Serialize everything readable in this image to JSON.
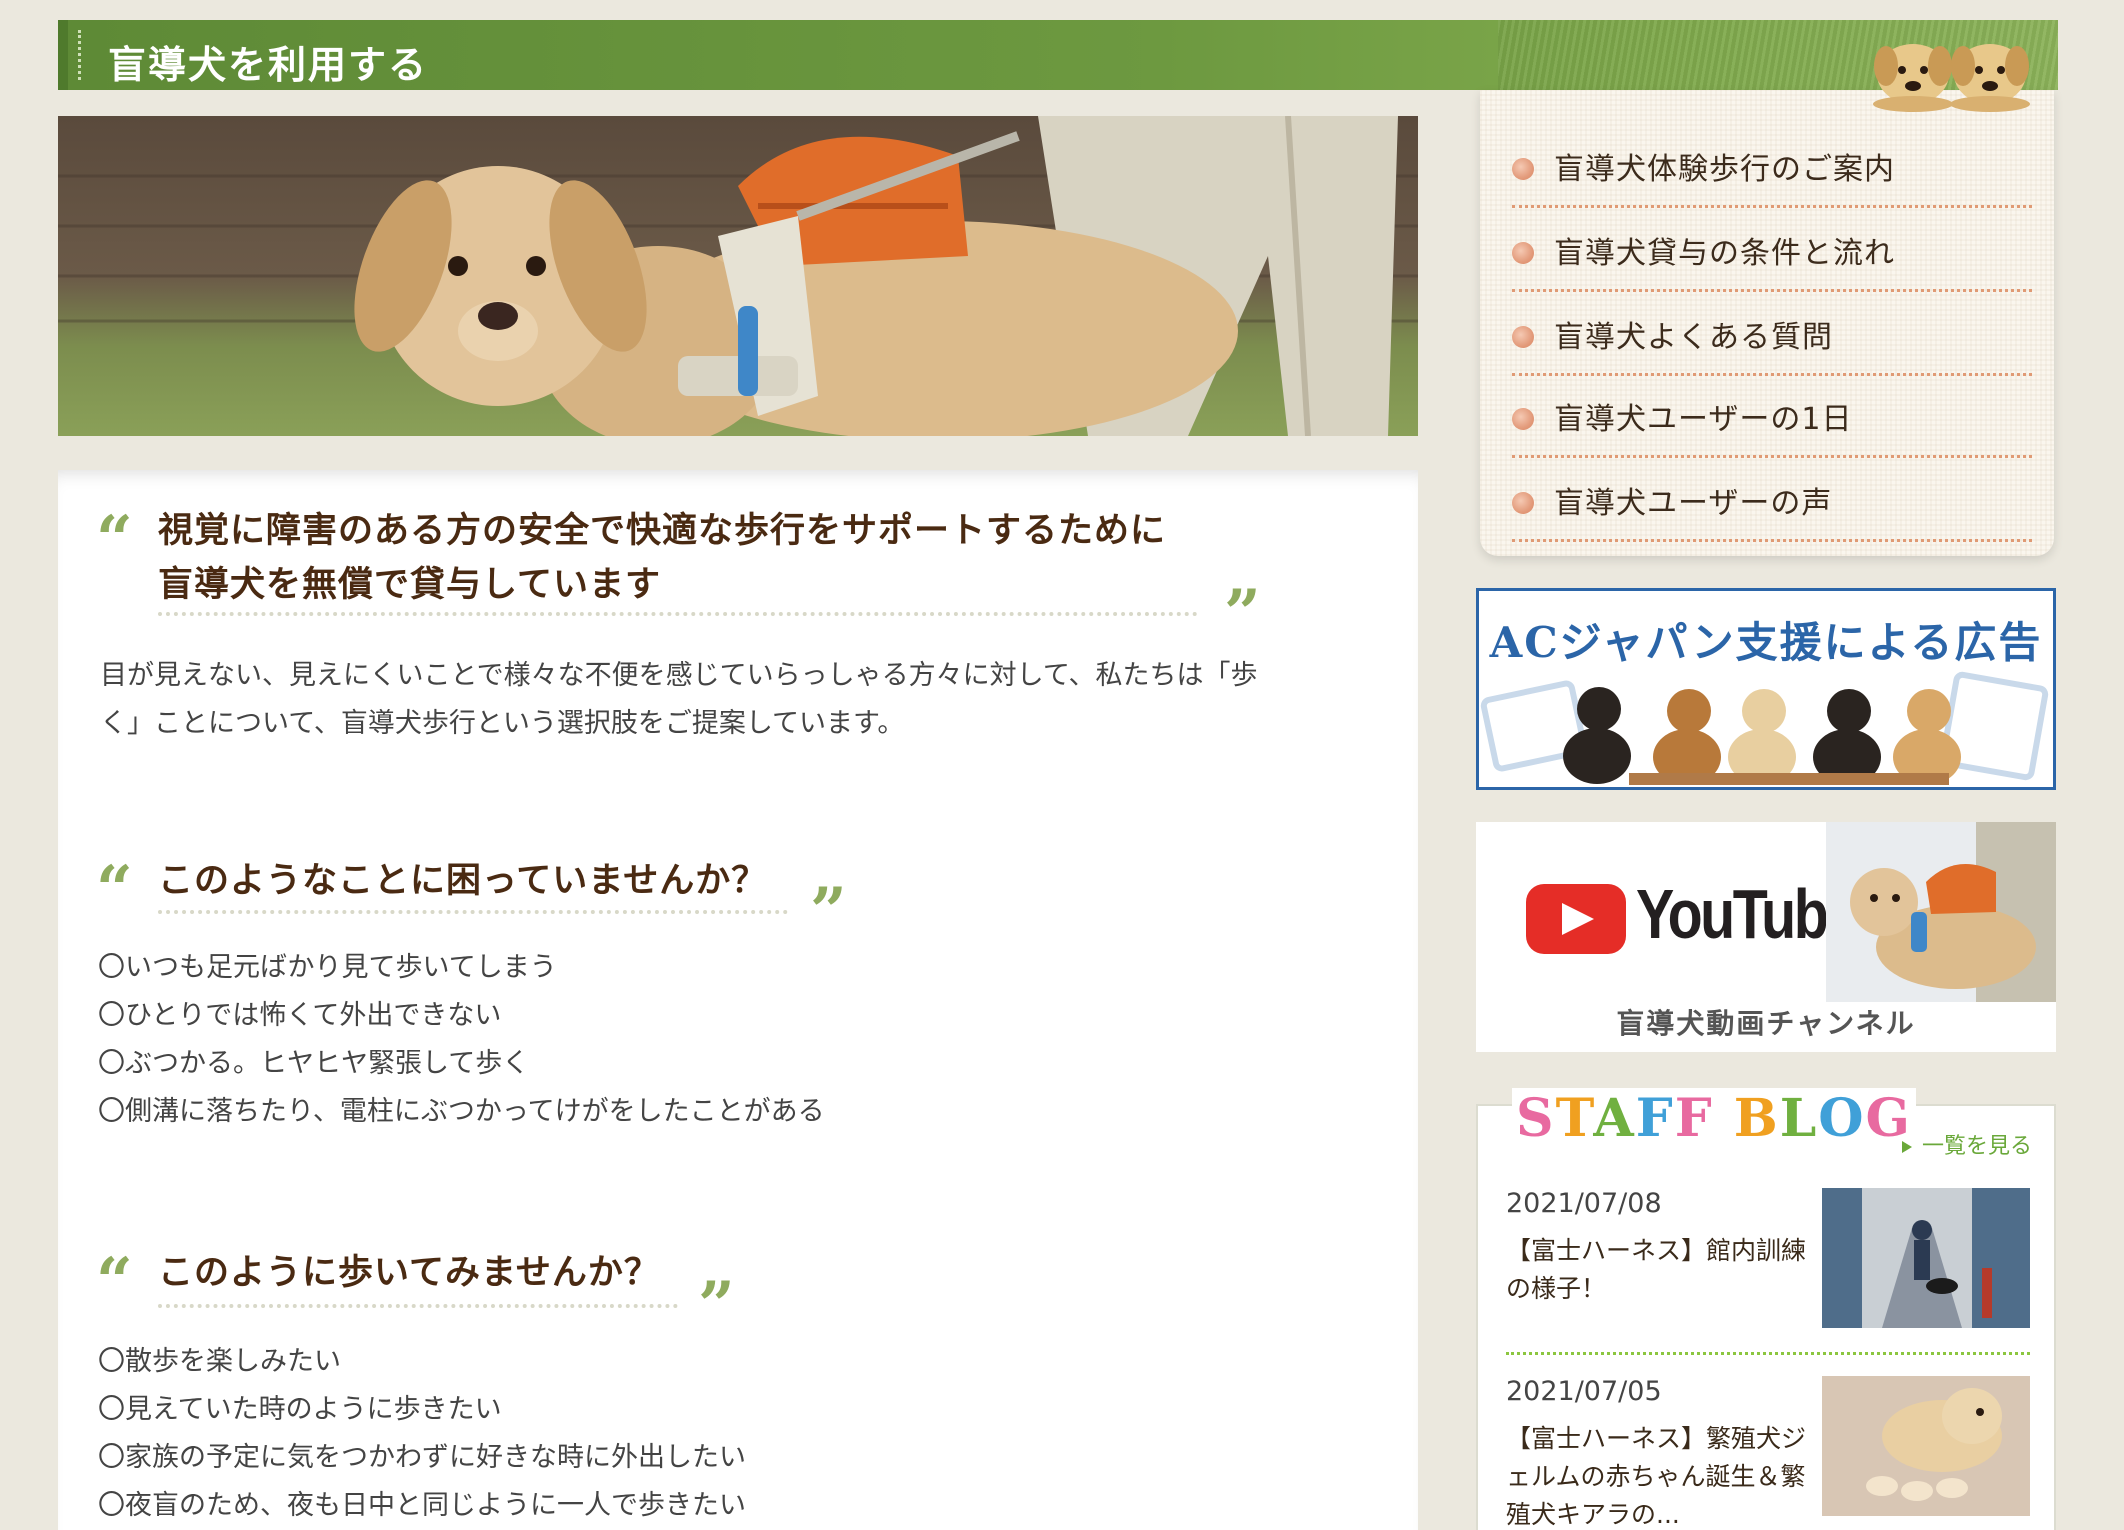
{
  "header": {
    "title": "盲導犬を利用する"
  },
  "hero": {
    "image": "guide-dog-with-harness-photo"
  },
  "intro": {
    "heading_line1": "視覚に障害のある方の安全で快適な歩行をサポートするために",
    "heading_line2": "盲導犬を無償で貸与しています",
    "body_line1": "目が見えない、見えにくいことで様々な不便を感じていらっしゃる方々に対して、私たちは「歩",
    "body_line2": "く」ことについて、盲導犬歩行という選択肢をご提案しています。"
  },
  "problems": {
    "heading": "このようなことに困っていませんか？",
    "items": [
      "〇いつも足元ばかり見て歩いてしまう",
      "〇ひとりでは怖くて外出できない",
      "〇ぶつかる。ヒヤヒヤ緊張して歩く",
      "〇側溝に落ちたり、電柱にぶつかってけがをしたことがある"
    ]
  },
  "wishes": {
    "heading": "このように歩いてみませんか？",
    "items": [
      "〇散歩を楽しみたい",
      "〇見えていた時のように歩きたい",
      "〇家族の予定に気をつかわずに好きな時に外出したい",
      "〇夜盲のため、夜も日中と同じように一人で歩きたい"
    ]
  },
  "sidebar": {
    "menu": [
      {
        "label": "盲導犬体験歩行のご案内"
      },
      {
        "label": "盲導犬貸与の条件と流れ"
      },
      {
        "label": "盲導犬よくある質問"
      },
      {
        "label": "盲導犬ユーザーの1日"
      },
      {
        "label": "盲導犬ユーザーの声"
      }
    ],
    "ac_banner": {
      "title": "ACジャパン支援による広告"
    },
    "youtube": {
      "word": "YouTube",
      "caption": "盲導犬動画チャンネル"
    },
    "blog": {
      "title": "STAFF BLOG",
      "more_label": "一覧を見る",
      "entries": [
        {
          "date": "2021/07/08",
          "text": "【富士ハーネス】館内訓練の様子！"
        },
        {
          "date": "2021/07/05",
          "text": "【富士ハーネス】繁殖犬ジェルムの赤ちゃん誕生＆繁殖犬キアラの..."
        }
      ]
    }
  },
  "colors": {
    "header_green": "#6d9940",
    "heading_brown": "#4a2a12",
    "quote_green": "#8fab5e",
    "menu_dot": "#e39b7b",
    "ac_blue": "#2b65a8",
    "youtube_red": "#e52d27",
    "blog_link_green": "#6aa83a"
  }
}
